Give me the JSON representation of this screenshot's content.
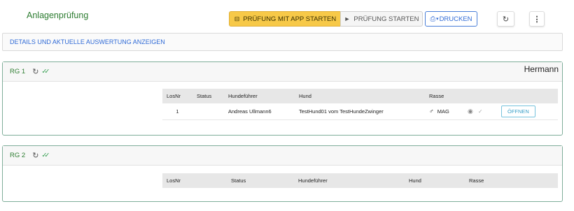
{
  "header": {
    "title": "Anlagenprüfung",
    "btn_app_start": "PRÜFUNG MIT APP STARTEN",
    "btn_start": "PRÜFUNG STARTEN",
    "btn_print": "DRUCKEN"
  },
  "details_link": "DETAILS UND AKTUELLE AUSWERTUNG ANZEIGEN",
  "groups": [
    {
      "title": "RG 1",
      "judge": "Hermann",
      "columns": [
        "LosNr",
        "Status",
        "Hundeführer",
        "Hund",
        "Rasse"
      ],
      "rows": [
        {
          "losnr": "1",
          "status": "",
          "handler": "Andreas Ullmann6",
          "dog": "TestHund01 vom TestHundeZwinger",
          "sex_icon": "male-icon",
          "breed": "MAG",
          "action": "ÖFFNEN"
        }
      ]
    },
    {
      "title": "RG 2",
      "judge": "",
      "columns": [
        "LosNr",
        "Status",
        "Hundeführer",
        "Hund",
        "Rasse"
      ],
      "rows": []
    }
  ],
  "colors": {
    "accent_green": "#2e7d32",
    "app_button": "#f7c948",
    "link_blue": "#2f6ad6",
    "group_border": "#7fae9a"
  }
}
